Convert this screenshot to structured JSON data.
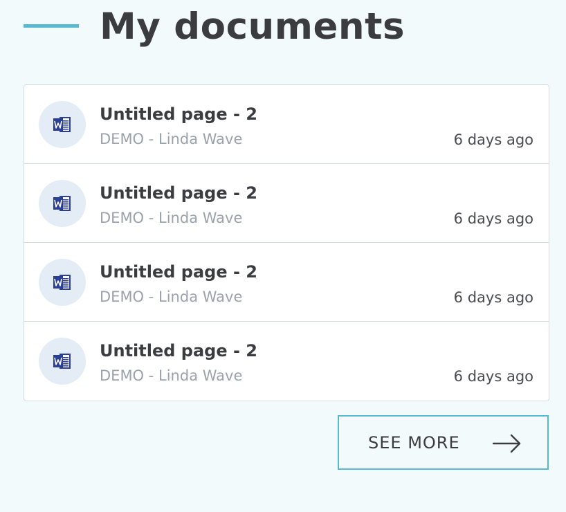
{
  "header": {
    "title": "My documents"
  },
  "documents": [
    {
      "icon": "word-document-icon",
      "title": "Untitled page - 2",
      "subtitle": "DEMO - Linda Wave",
      "modified": "6 days ago"
    },
    {
      "icon": "word-document-icon",
      "title": "Untitled page - 2",
      "subtitle": "DEMO - Linda Wave",
      "modified": "6 days ago"
    },
    {
      "icon": "word-document-icon",
      "title": "Untitled page - 2",
      "subtitle": "DEMO - Linda Wave",
      "modified": "6 days ago"
    },
    {
      "icon": "word-document-icon",
      "title": "Untitled page - 2",
      "subtitle": "DEMO - Linda Wave",
      "modified": "6 days ago"
    }
  ],
  "see_more": {
    "label": "SEE MORE",
    "icon": "arrow-right-icon"
  },
  "colors": {
    "background": "#f3fafc",
    "accent": "#56b9d2",
    "word_blue": "#2b3f94",
    "icon_circle": "#e4ecf6",
    "title_text": "#3b3c3f",
    "muted_text": "#9aa2ab"
  }
}
